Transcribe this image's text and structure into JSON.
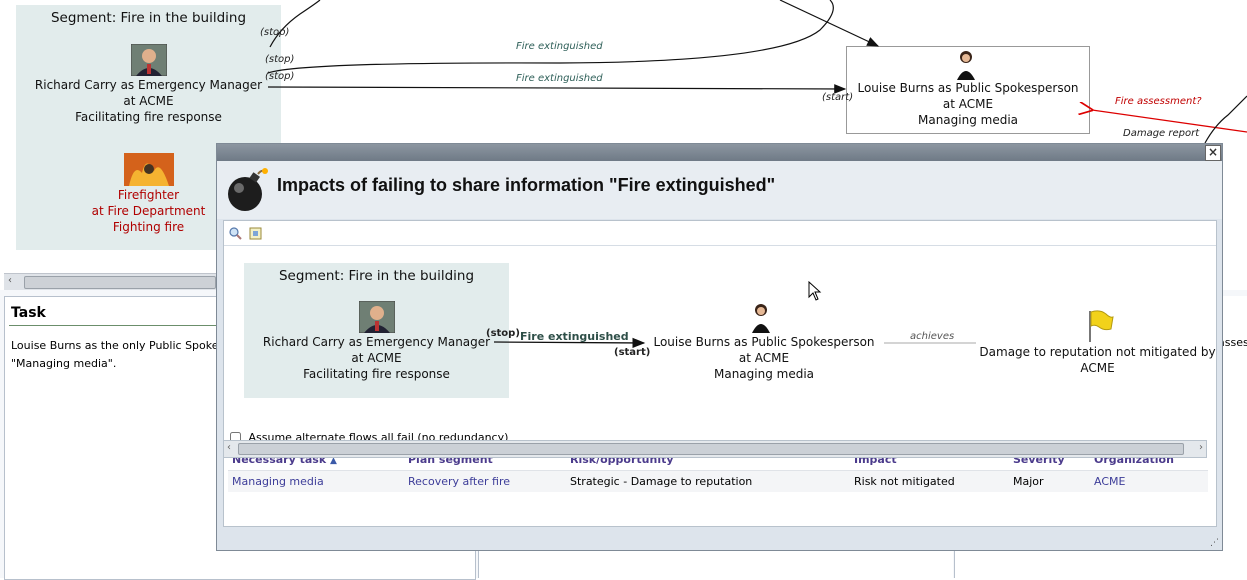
{
  "background": {
    "segment_title": "Segment: Fire in the building",
    "manager_node": [
      "Richard Carry as Emergency Manager",
      "at ACME",
      "Facilitating fire response"
    ],
    "firefighter_node": [
      "Firefighter",
      "at Fire Department",
      "Fighting fire"
    ],
    "spokes_node": [
      "Louise Burns as Public Spokesperson",
      "at ACME",
      "Managing media"
    ],
    "labels": {
      "stop1": "(stop)",
      "stop2": "(stop)",
      "stop3": "(stop)",
      "flow1": "Fire extinguished",
      "flow2": "Fire extinguished",
      "start": "(start)",
      "fire_assessment": "Fire assessment?",
      "damage_report": "Damage report"
    },
    "task_panel": {
      "title": "Task",
      "body_line1": "Louise Burns as the only Public Spoke",
      "body_line2": "\"Managing media\"."
    },
    "right_fragment": "asses"
  },
  "dialog": {
    "title": "Impacts of failing to share information \"Fire extinguished\"",
    "close_label": "×",
    "diagram": {
      "segment_title": "Segment: Fire in the building",
      "manager_node": [
        "Richard Carry as Emergency Manager",
        "at ACME",
        "Facilitating fire response"
      ],
      "flow_label": "Fire extinguished",
      "stop_label": "(stop)",
      "start_label": "(start)",
      "spokes_node": [
        "Louise Burns as Public Spokesperson",
        "at ACME",
        "Managing media"
      ],
      "achieves_label": "achieves",
      "risk_node": [
        "Damage to reputation not mitigated by",
        "ACME"
      ]
    },
    "checkbox_label": "Assume alternate flows all fail (no redundancy)",
    "table": {
      "headers": [
        "Necessary task",
        "Plan segment",
        "Risk/opportunity",
        "Impact",
        "Severity",
        "Organization"
      ],
      "rows": [
        [
          "Managing media",
          "Recovery after fire",
          "Strategic - Damage to reputation",
          "Risk not mitigated",
          "Major",
          "ACME"
        ]
      ]
    }
  },
  "colors": {
    "segment_bg": "#e2ecec",
    "link": "#3d3d99",
    "header": "#4b3b8c",
    "danger": "#c00000"
  }
}
